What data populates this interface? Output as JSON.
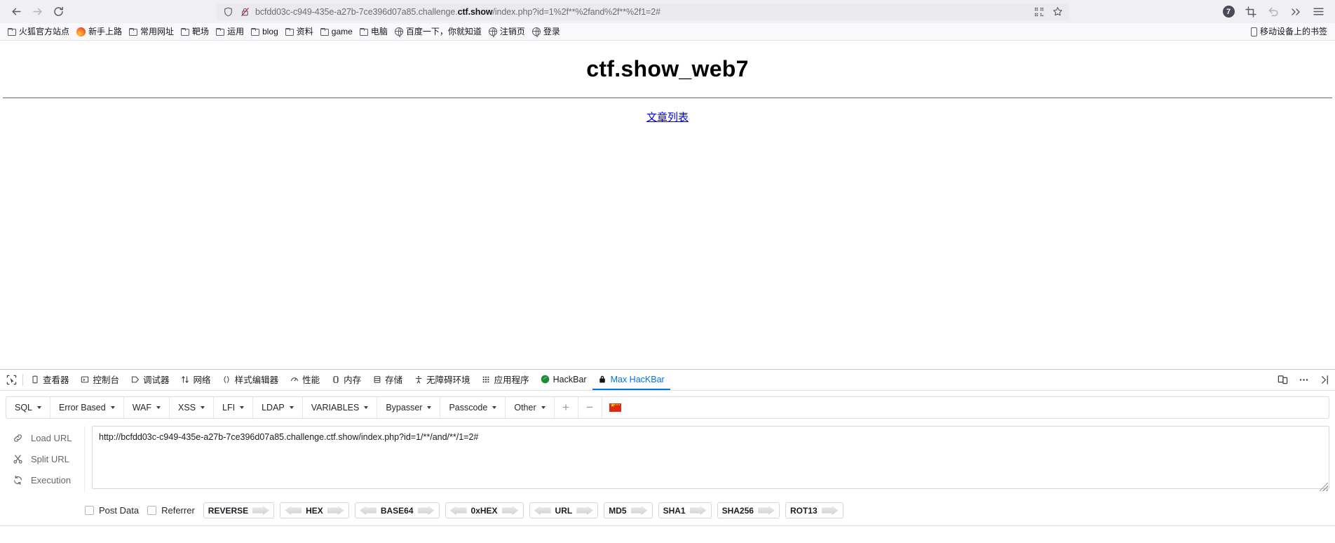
{
  "browser": {
    "nav": {
      "back_label": "Back",
      "forward_label": "Forward",
      "reload_label": "Reload"
    },
    "urlbar": {
      "url_prefix": "bcfdd03c-c949-435e-a27b-7ce396d07a85.challenge.",
      "url_host_strong": "ctf.show",
      "url_suffix": "/index.php?id=1%2f**%2fand%2f**%2f1=2#",
      "full_url": "bcfdd03c-c949-435e-a27b-7ce396d07a85.challenge.ctf.show/index.php?id=1%2f**%2fand%2f**%2f1=2#",
      "shield_icon": "shield-icon",
      "insecure_icon": "broken-lock-icon",
      "qr_icon": "qr-code-icon",
      "bookmark_icon": "star-icon"
    },
    "toolbar_right": {
      "notification_count": "7",
      "screenshot_icon": "crop-screenshot-icon",
      "undo_icon": "undo-arrow-icon",
      "overflow_icon": "chevron-double-right-icon",
      "menu_icon": "hamburger-menu-icon"
    },
    "bookmarks": [
      {
        "label": "火狐官方站点",
        "icon": "folder-icon"
      },
      {
        "label": "新手上路",
        "icon": "firefox-icon"
      },
      {
        "label": "常用网址",
        "icon": "folder-icon"
      },
      {
        "label": "靶场",
        "icon": "folder-icon"
      },
      {
        "label": "运用",
        "icon": "folder-icon"
      },
      {
        "label": "blog",
        "icon": "folder-icon"
      },
      {
        "label": "资料",
        "icon": "folder-icon"
      },
      {
        "label": "game",
        "icon": "folder-icon"
      },
      {
        "label": "电脑",
        "icon": "folder-icon"
      },
      {
        "label": "百度一下，你就知道",
        "icon": "globe-icon"
      },
      {
        "label": "注销页",
        "icon": "globe-icon"
      },
      {
        "label": "登录",
        "icon": "globe-icon"
      }
    ],
    "bookmarks_right": {
      "label": "移动设备上的书签",
      "icon": "mobile-icon"
    }
  },
  "page": {
    "title": "ctf.show_web7",
    "link_text": "文章列表"
  },
  "devtools": {
    "picker_icon": "element-picker-icon",
    "tabs": [
      {
        "label": "查看器",
        "icon": "inspector-icon",
        "active": false
      },
      {
        "label": "控制台",
        "icon": "console-icon",
        "active": false
      },
      {
        "label": "调试器",
        "icon": "debugger-icon",
        "active": false
      },
      {
        "label": "网络",
        "icon": "network-icon",
        "active": false
      },
      {
        "label": "样式编辑器",
        "icon": "style-editor-icon",
        "active": false
      },
      {
        "label": "性能",
        "icon": "performance-icon",
        "active": false
      },
      {
        "label": "内存",
        "icon": "memory-icon",
        "active": false
      },
      {
        "label": "存储",
        "icon": "storage-icon",
        "active": false
      },
      {
        "label": "无障碍环境",
        "icon": "accessibility-icon",
        "active": false
      },
      {
        "label": "应用程序",
        "icon": "application-icon",
        "active": false
      },
      {
        "label": "HackBar",
        "icon": "hackbar-icon",
        "active": false
      },
      {
        "label": "Max HacKBar",
        "icon": "lock-icon",
        "active": true
      }
    ],
    "right_buttons": [
      {
        "icon": "responsive-design-mode-icon",
        "label": ""
      },
      {
        "icon": "meatball-menu-icon",
        "label": ""
      },
      {
        "icon": "close-devtools-icon",
        "label": ""
      }
    ],
    "active_tab_color": "#0074e8"
  },
  "hackbar": {
    "menus": [
      {
        "label": "SQL"
      },
      {
        "label": "Error Based"
      },
      {
        "label": "WAF"
      },
      {
        "label": "XSS"
      },
      {
        "label": "LFI"
      },
      {
        "label": "LDAP"
      },
      {
        "label": "VARIABLES"
      },
      {
        "label": "Bypasser"
      },
      {
        "label": "Passcode"
      },
      {
        "label": "Other"
      }
    ],
    "add_label": "+",
    "remove_label": "−",
    "flag_icon": "china-flag-icon",
    "actions": [
      {
        "label": "Load URL",
        "icon": "link-icon"
      },
      {
        "label": "Split URL",
        "icon": "scissors-icon"
      },
      {
        "label": "Execution",
        "icon": "refresh-icon"
      }
    ],
    "url_textarea": {
      "value": "http://bcfdd03c-c949-435e-a27b-7ce396d07a85.challenge.ctf.show/index.php?id=1/**/and/**/1=2#",
      "placeholder": ""
    },
    "checkboxes": [
      {
        "label": "Post Data",
        "checked": false
      },
      {
        "label": "Referrer",
        "checked": false
      }
    ],
    "encoders": [
      {
        "label": "REVERSE",
        "decode": false,
        "encode": true
      },
      {
        "label": "HEX",
        "decode": true,
        "encode": true
      },
      {
        "label": "BASE64",
        "decode": true,
        "encode": true
      },
      {
        "label": "0xHEX",
        "decode": true,
        "encode": true
      },
      {
        "label": "URL",
        "decode": true,
        "encode": true
      },
      {
        "label": "MD5",
        "decode": false,
        "encode": true
      },
      {
        "label": "SHA1",
        "decode": false,
        "encode": true
      },
      {
        "label": "SHA256",
        "decode": false,
        "encode": true
      },
      {
        "label": "ROT13",
        "decode": false,
        "encode": true
      }
    ]
  }
}
